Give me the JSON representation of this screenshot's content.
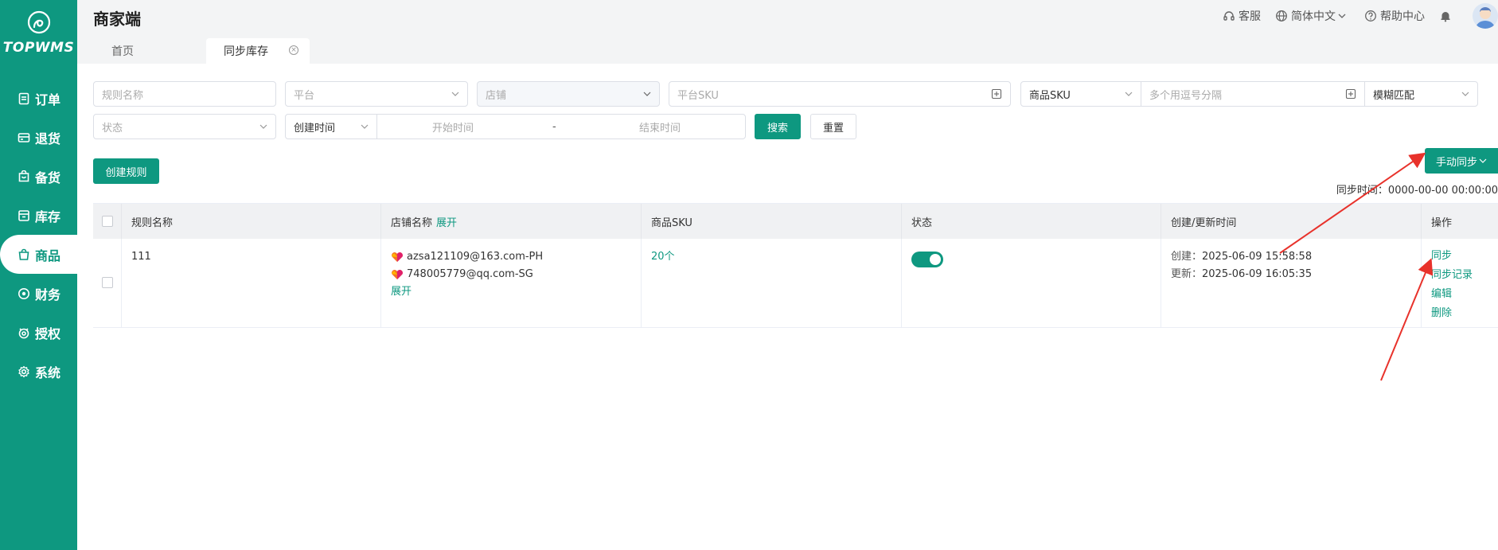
{
  "app": {
    "logo_text": "TOPWMS",
    "title": "商家端"
  },
  "sidebar": {
    "items": [
      {
        "label": "订单",
        "icon": "order-icon",
        "active": false
      },
      {
        "label": "退货",
        "icon": "return-icon",
        "active": false
      },
      {
        "label": "备货",
        "icon": "stock-prep-icon",
        "active": false
      },
      {
        "label": "库存",
        "icon": "inventory-icon",
        "active": false
      },
      {
        "label": "商品",
        "icon": "product-icon",
        "active": true
      },
      {
        "label": "财务",
        "icon": "finance-icon",
        "active": false
      },
      {
        "label": "授权",
        "icon": "auth-icon",
        "active": false
      },
      {
        "label": "系统",
        "icon": "settings-icon",
        "active": false
      }
    ]
  },
  "header": {
    "support": "客服",
    "language": "简体中文",
    "help": "帮助中心"
  },
  "tabs": [
    {
      "label": "首页"
    },
    {
      "label": "同步库存"
    }
  ],
  "filters": {
    "rule_name_placeholder": "规则名称",
    "platform_placeholder": "平台",
    "shop_placeholder": "店铺",
    "platform_sku_placeholder": "平台SKU",
    "sku_type_value": "商品SKU",
    "multi_placeholder": "多个用逗号分隔",
    "match_value": "模糊匹配",
    "status_placeholder": "状态",
    "time_type_value": "创建时间",
    "start_placeholder": "开始时间",
    "range_sep": "-",
    "end_placeholder": "结束时间",
    "search_label": "搜索",
    "reset_label": "重置"
  },
  "toolbar": {
    "create_label": "创建规则",
    "manual_sync_label": "手动同步",
    "sync_time_label": "同步时间：",
    "sync_time_value": "0000-00-00 00:00:00"
  },
  "table": {
    "headers": {
      "rule_name": "规则名称",
      "shop_name": "店铺名称",
      "shop_expand": "展开",
      "sku": "商品SKU",
      "status": "状态",
      "time": "创建/更新时间",
      "ops": "操作"
    },
    "rows": [
      {
        "rule_name": "111",
        "shops": [
          "azsa121109@163.com-PH",
          "748005779@qq.com-SG"
        ],
        "shop_expand": "展开",
        "sku": "20个",
        "status_on": true,
        "created_label": "创建：",
        "created": "2025-06-09 15:58:58",
        "updated_label": "更新：",
        "updated": "2025-06-09 16:05:35",
        "ops": [
          "同步",
          "同步记录",
          "编辑",
          "删除"
        ]
      }
    ]
  },
  "colors": {
    "brand": "#0e9880",
    "annotation": "#e8322b"
  }
}
